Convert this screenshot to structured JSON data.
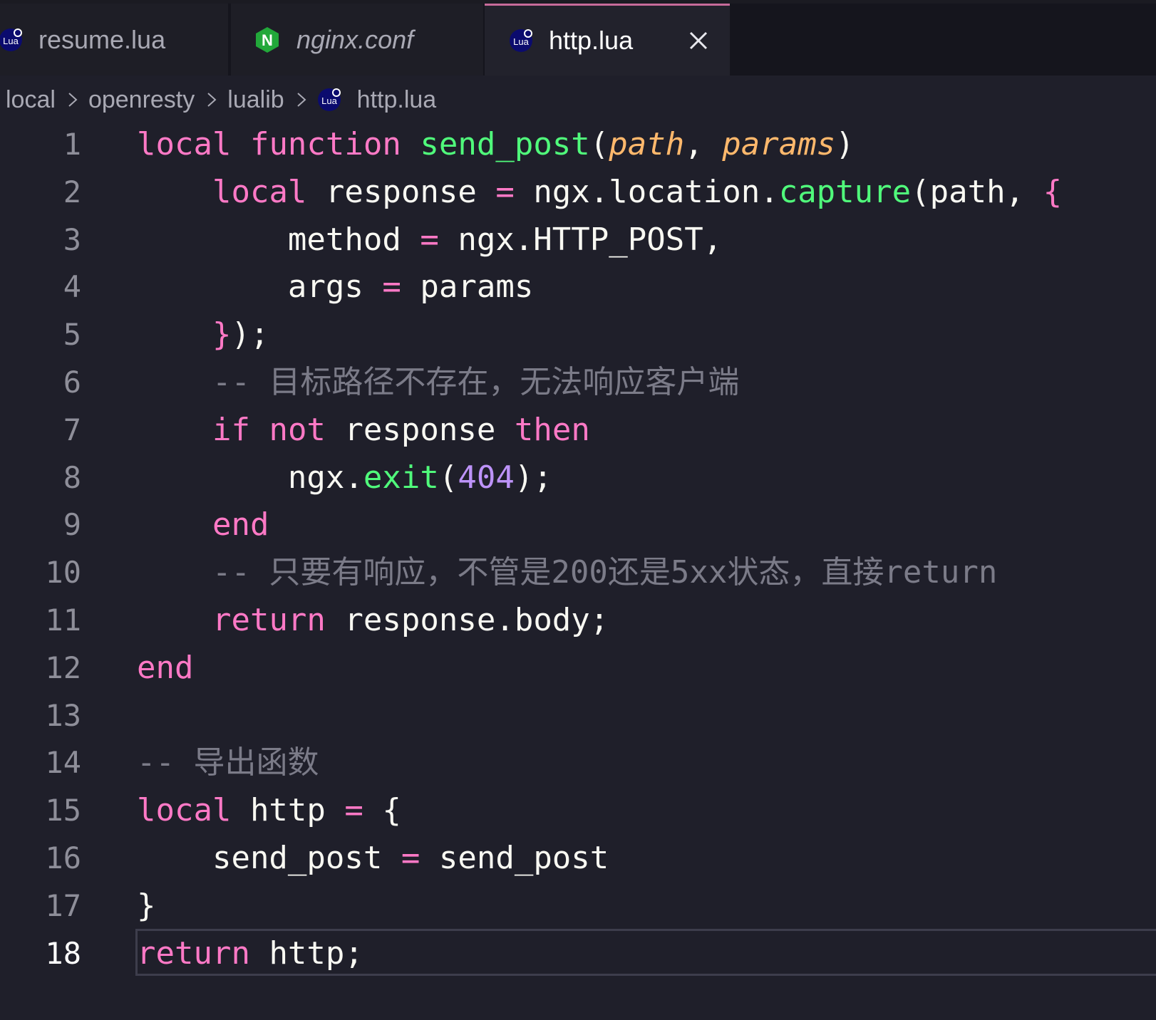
{
  "tabs": [
    {
      "label": "resume.lua",
      "icon": "lua-icon",
      "active": false,
      "italic": false
    },
    {
      "label": "nginx.conf",
      "icon": "nginx-icon",
      "active": false,
      "italic": true
    },
    {
      "label": "http.lua",
      "icon": "lua-icon",
      "active": true,
      "italic": false
    }
  ],
  "icons": {
    "lua_text": "Lua",
    "nginx_text": "N"
  },
  "breadcrumb": [
    "local",
    "openresty",
    "lualib",
    "http.lua"
  ],
  "colors": {
    "keyword": "#ff79c6",
    "function": "#50fa7b",
    "parameter": "#ffb86c",
    "number": "#bd93f9",
    "comment": "#7b7b88",
    "active_tab_accent": "#c76b9a"
  },
  "editor": {
    "current_line": 18,
    "lines": [
      {
        "n": "1",
        "t": [
          [
            "local",
            "kw"
          ],
          [
            " ",
            "pl"
          ],
          [
            "function",
            "kw"
          ],
          [
            " ",
            "pl"
          ],
          [
            "send_post",
            "fn"
          ],
          [
            "(",
            "pl"
          ],
          [
            "path",
            "param"
          ],
          [
            ", ",
            "pl"
          ],
          [
            "params",
            "param"
          ],
          [
            ")",
            "pl"
          ]
        ]
      },
      {
        "n": "2",
        "t": [
          [
            "    ",
            "pl"
          ],
          [
            "local",
            "kw"
          ],
          [
            " response ",
            "pl"
          ],
          [
            "=",
            "op"
          ],
          [
            " ngx.location.",
            "pl"
          ],
          [
            "capture",
            "fn"
          ],
          [
            "(path, ",
            "pl"
          ],
          [
            "{",
            "kw"
          ]
        ]
      },
      {
        "n": "3",
        "t": [
          [
            "        method ",
            "pl"
          ],
          [
            "=",
            "op"
          ],
          [
            " ngx.HTTP_POST,",
            "pl"
          ]
        ]
      },
      {
        "n": "4",
        "t": [
          [
            "        args ",
            "pl"
          ],
          [
            "=",
            "op"
          ],
          [
            " params",
            "pl"
          ]
        ]
      },
      {
        "n": "5",
        "t": [
          [
            "    ",
            "pl"
          ],
          [
            "}",
            "kw"
          ],
          [
            ");",
            "pl"
          ]
        ]
      },
      {
        "n": "6",
        "t": [
          [
            "    -- 目标路径不存在，无法响应客户端",
            "cm"
          ]
        ]
      },
      {
        "n": "7",
        "t": [
          [
            "    ",
            "pl"
          ],
          [
            "if",
            "kw"
          ],
          [
            " ",
            "pl"
          ],
          [
            "not",
            "kw"
          ],
          [
            " response ",
            "pl"
          ],
          [
            "then",
            "kw"
          ]
        ]
      },
      {
        "n": "8",
        "t": [
          [
            "        ngx.",
            "pl"
          ],
          [
            "exit",
            "fn"
          ],
          [
            "(",
            "pl"
          ],
          [
            "404",
            "num"
          ],
          [
            ");",
            "pl"
          ]
        ]
      },
      {
        "n": "9",
        "t": [
          [
            "    ",
            "pl"
          ],
          [
            "end",
            "kw"
          ]
        ]
      },
      {
        "n": "10",
        "t": [
          [
            "    -- 只要有响应，不管是200还是5xx状态，直接return",
            "cm"
          ]
        ]
      },
      {
        "n": "11",
        "t": [
          [
            "    ",
            "pl"
          ],
          [
            "return",
            "kw"
          ],
          [
            " response.body;",
            "pl"
          ]
        ]
      },
      {
        "n": "12",
        "t": [
          [
            "end",
            "kw"
          ]
        ]
      },
      {
        "n": "13",
        "t": []
      },
      {
        "n": "14",
        "t": [
          [
            "-- 导出函数",
            "cm"
          ]
        ]
      },
      {
        "n": "15",
        "t": [
          [
            "local",
            "kw"
          ],
          [
            " http ",
            "pl"
          ],
          [
            "=",
            "op"
          ],
          [
            " {",
            "pl"
          ]
        ]
      },
      {
        "n": "16",
        "t": [
          [
            "    send_post ",
            "pl"
          ],
          [
            "=",
            "op"
          ],
          [
            " send_post",
            "pl"
          ]
        ]
      },
      {
        "n": "17",
        "t": [
          [
            "}",
            "pl"
          ]
        ]
      },
      {
        "n": "18",
        "t": [
          [
            "return",
            "kw"
          ],
          [
            " http;",
            "pl"
          ]
        ]
      }
    ]
  }
}
